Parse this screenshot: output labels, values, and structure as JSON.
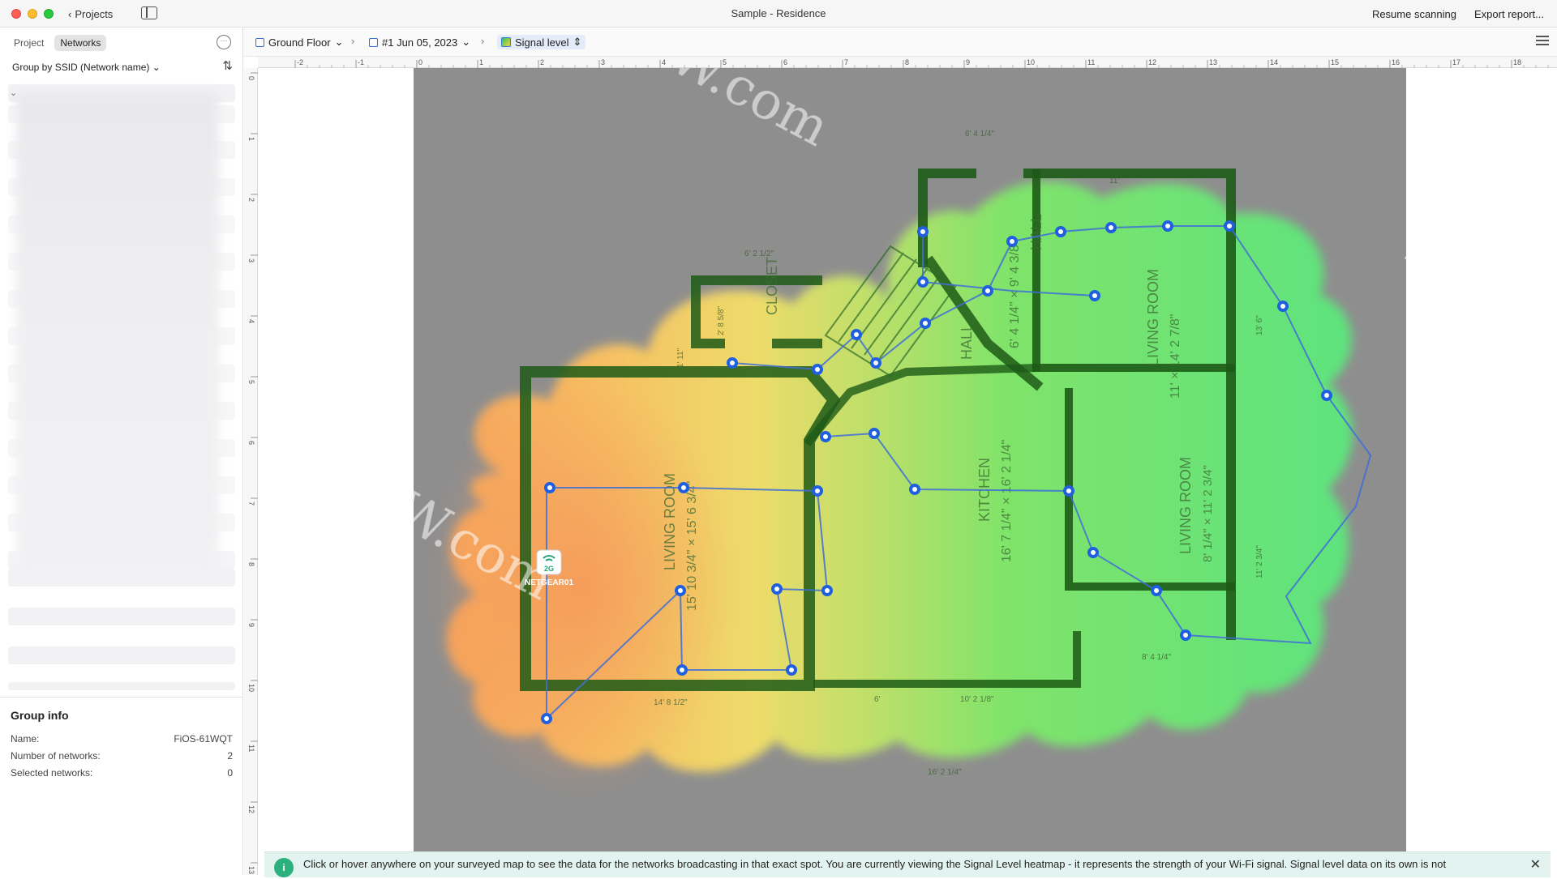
{
  "window": {
    "title": "Sample - Residence",
    "back_label": "Projects",
    "resume_label": "Resume scanning",
    "export_label": "Export report..."
  },
  "sidebar": {
    "tabs": [
      "Project",
      "Networks"
    ],
    "active_tab": "Networks",
    "group_by": "Group by SSID (Network name)",
    "group_info": {
      "title": "Group info",
      "name_label": "Name:",
      "name_value": "FiOS-61WQT",
      "count_label": "Number of networks:",
      "count_value": "2",
      "selected_label": "Selected networks:",
      "selected_value": "0"
    }
  },
  "toolbar": {
    "floor": "Ground Floor",
    "survey": "#1 Jun 05, 2023",
    "view": "Signal level"
  },
  "ruler": {
    "top_ticks": [
      "-2",
      "-1",
      "0",
      "1",
      "2",
      "3",
      "4",
      "5",
      "6",
      "7",
      "8",
      "9",
      "10",
      "11",
      "12",
      "13",
      "14",
      "15",
      "16",
      "17",
      "18"
    ],
    "left_ticks": [
      "0",
      "1",
      "2",
      "3",
      "4",
      "5",
      "6",
      "7",
      "8",
      "9",
      "10",
      "11",
      "12",
      "13"
    ]
  },
  "map": {
    "rooms": [
      {
        "label": "CLOSET"
      },
      {
        "label": "HALL"
      },
      {
        "label": "HALL",
        "dims": "6' 4 1/4\" × 9' 4 3/8\""
      },
      {
        "label": "LIVING ROOM",
        "dims": "11' × 14' 2 7/8\""
      },
      {
        "label": "LIVING ROOM",
        "dims": "15' 10 3/4\" × 15' 6 3/4\""
      },
      {
        "label": "KITCHEN",
        "dims": "16' 7 1/4\" × 16' 2 1/4\""
      },
      {
        "label": "LIVING ROOM",
        "dims": "8' 1/4\" × 11' 2 3/4\""
      }
    ],
    "dimension_labels": [
      "6' 4 1/4\"",
      "11'",
      "6' 2 1/2\"",
      "14' 8 1/2\"",
      "10' 2 1/8\"",
      "16' 2 1/4\"",
      "8' 4 1/4\"",
      "13' 6\"",
      "11' 2 3/4\"",
      "2' 8 5/8\"",
      "1' 11\"",
      "6'"
    ],
    "access_point": {
      "band": "2G",
      "name": "NETGEAR01"
    }
  },
  "banner": {
    "text": "Click or hover anywhere on your surveyed map to see the data for the networks broadcasting in that exact spot. You are currently viewing the Signal Level heatmap - it represents the strength of your Wi-Fi signal. Signal level data on its own is not"
  },
  "watermark": "MacW.com",
  "colors": {
    "accent": "#1f5fe0",
    "heat_strong": "#3ecf4c",
    "heat_weak": "#f7a65a",
    "wall": "#1c5d14"
  }
}
